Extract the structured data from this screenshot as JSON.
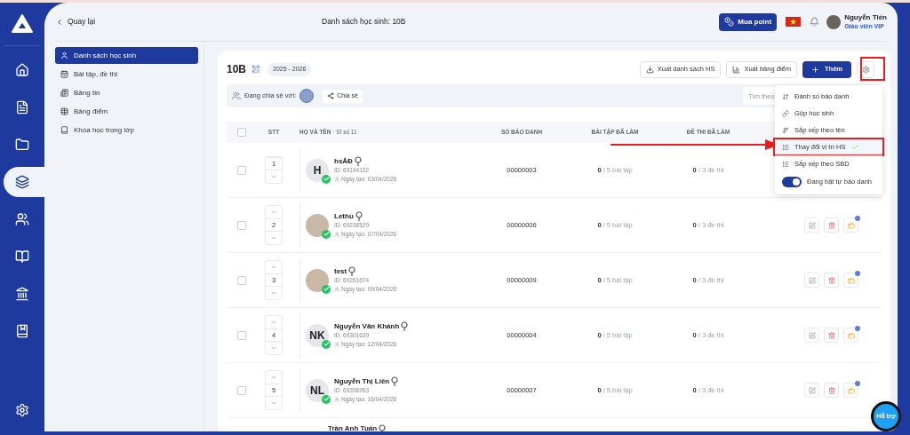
{
  "nav": [
    {
      "selected": false
    },
    {
      "selected": false
    },
    {
      "selected": false
    },
    {
      "selected": true
    },
    {
      "selected": false
    },
    {
      "selected": false
    },
    {
      "selected": false
    },
    {
      "selected": false
    }
  ],
  "header": {
    "back": "Quay lại",
    "title": "Danh sách học sinh: 10B",
    "buy_button": "Mua point",
    "user_name": "Nguyễn Tiến",
    "user_role": "Giáo viên VIP"
  },
  "sidebar": {
    "items": [
      {
        "label": "Danh sách học sinh",
        "selected": true
      },
      {
        "label": "Bài tập, đề thi",
        "selected": false
      },
      {
        "label": "Bảng tin",
        "selected": false
      },
      {
        "label": "Bảng điểm",
        "selected": false
      },
      {
        "label": "Khóa học trong lớp",
        "selected": false
      }
    ]
  },
  "class": {
    "name": "10B",
    "year": "2025 - 2026",
    "export_list": "Xuất danh sách HS",
    "export_scores": "Xuất bảng điểm",
    "add": "Thêm"
  },
  "share": {
    "label": "Đang chia sẻ với:",
    "button": "Chia sẻ",
    "search_placeholder": "Tìm theo"
  },
  "menu": [
    {
      "kind": "item",
      "label": "Đánh số báo danh",
      "selected": false
    },
    {
      "kind": "item",
      "label": "Gộp học sinh",
      "selected": false
    },
    {
      "kind": "item",
      "label": "Sắp xếp theo tên",
      "selected": false
    },
    {
      "kind": "item",
      "label": "Thay đổi vị trí HS",
      "selected": true
    },
    {
      "kind": "item",
      "label": "Sắp xếp theo SBD",
      "selected": false
    },
    {
      "kind": "toggle",
      "label": "Đang bật tự báo danh",
      "on": true
    }
  ],
  "table": {
    "columns": [
      "STT",
      "HỌ VÀ TÊN",
      "SỐ BÁO DANH",
      "BÀI TẬP ĐÃ LÀM",
      "ĐỀ THI ĐÃ LÀM"
    ],
    "count": "· Sĩ số 11",
    "all_checked": false,
    "rows": [
      {
        "checked": false,
        "stt": "1",
        "name": "hsĂĐ",
        "kind": "initials",
        "initials": "H",
        "id": "ID: 69194102",
        "created": "Ngày tạo: 03/04/2026",
        "sbd": "00000003",
        "done_hw": "0",
        "total_hw": "/ 5 bài tập",
        "done_exam": "0",
        "total_exam": "/ 3 đề thi"
      },
      {
        "checked": false,
        "stt": "2",
        "name": "Lethu",
        "kind": "image",
        "id": "ID: 69238529",
        "created": "Ngày tạo: 07/04/2026",
        "sbd": "00000006",
        "done_hw": "0",
        "total_hw": "/ 5 bài tập",
        "done_exam": "0",
        "total_exam": "/ 3 đề thi"
      },
      {
        "checked": false,
        "stt": "3",
        "name": "test",
        "kind": "image",
        "id": "ID: 69261674",
        "created": "Ngày tạo: 09/04/2026",
        "sbd": "00000009",
        "done_hw": "0",
        "total_hw": "/ 5 bài tập",
        "done_exam": "0",
        "total_exam": "/ 3 đề thi"
      },
      {
        "checked": false,
        "stt": "4",
        "name": "Nguyễn Văn Khánh",
        "kind": "initials",
        "initials": "NK",
        "id": "ID: 69301639",
        "created": "Ngày tạo: 12/04/2026",
        "sbd": "00000004",
        "done_hw": "0",
        "total_hw": "/ 5 bài tập",
        "done_exam": "0",
        "total_exam": "/ 3 đề thi"
      },
      {
        "checked": false,
        "stt": "5",
        "name": "Nguyễn Thị Liên",
        "kind": "initials",
        "initials": "NL",
        "id": "ID: 69358953",
        "created": "Ngày tạo: 16/04/2026",
        "sbd": "00000007",
        "done_hw": "0",
        "total_hw": "/ 5 bài tập",
        "done_exam": "0",
        "total_exam": "/ 3 đề thi"
      }
    ],
    "partial_row": {
      "name": "Trần Anh Tuấn"
    }
  },
  "support": "Hỗ trợ"
}
